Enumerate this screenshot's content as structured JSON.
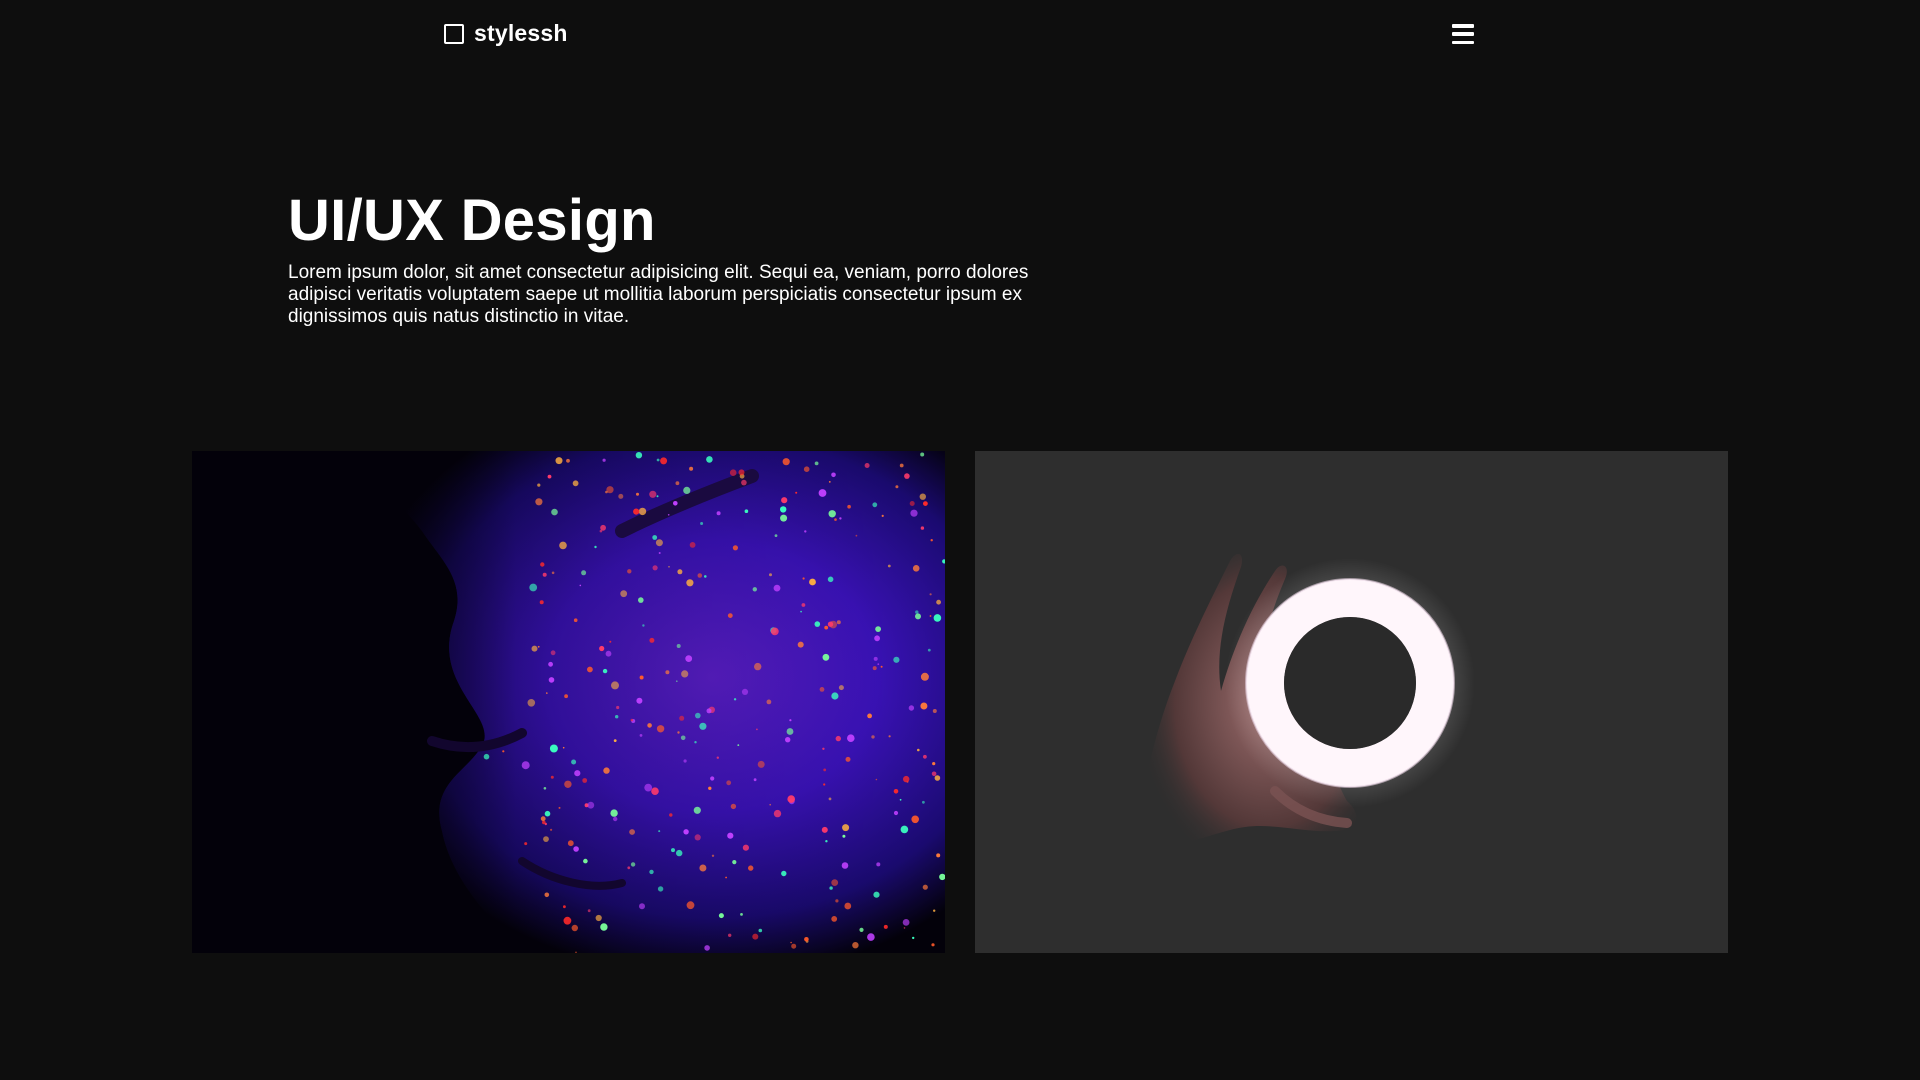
{
  "navbar": {
    "brand_icon": "square-outline-icon",
    "brand_name": "stylessh",
    "menu_icon": "hamburger-menu-icon"
  },
  "hero": {
    "title": "UI/UX Design",
    "description": "Lorem ipsum dolor, sit amet consectetur adipisicing elit. Sequi ea, veniam, porro dolores adipisci veritatis voluptatem saepe ut mollitia laborum perspiciatis consectetur ipsum ex dignissimos quis natus distinctio in vitae."
  },
  "gallery": {
    "images": [
      {
        "subject": "face-with-neon-uv-paint"
      },
      {
        "subject": "hand-holding-ring-light"
      }
    ]
  },
  "colors": {
    "background": "#0e0e0e",
    "text": "#ffffff",
    "card_dark": "#2e2e2e"
  }
}
